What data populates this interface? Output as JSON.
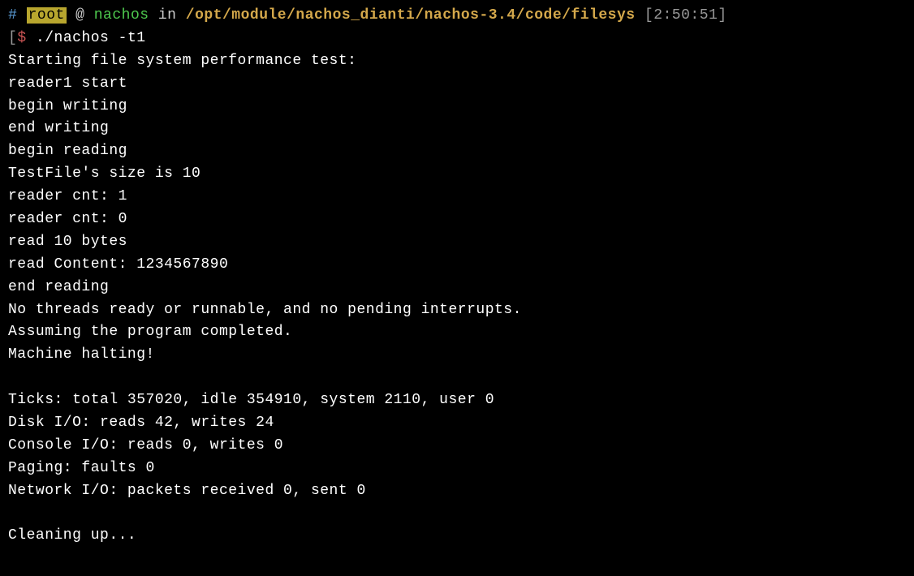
{
  "prompt": {
    "hash": "#",
    "user": "root",
    "at": " @ ",
    "hostname": "nachos",
    "in": " in ",
    "path": "/opt/module/nachos_dianti/nachos-3.4/code/filesys",
    "timestamp": "2:50:51",
    "lbracket": " [",
    "rbracket": "]"
  },
  "command_line": {
    "lbracket": "[",
    "dollar": "$",
    "space": " ",
    "command": "./nachos -t1"
  },
  "output": [
    "Starting file system performance test:",
    "reader1 start",
    "begin writing",
    "end writing",
    "begin reading",
    "TestFile's size is 10",
    "reader cnt: 1",
    "reader cnt: 0",
    "read 10 bytes",
    "read Content: 1234567890",
    "end reading",
    "No threads ready or runnable, and no pending interrupts.",
    "Assuming the program completed.",
    "Machine halting!",
    "",
    "Ticks: total 357020, idle 354910, system 2110, user 0",
    "Disk I/O: reads 42, writes 24",
    "Console I/O: reads 0, writes 0",
    "Paging: faults 0",
    "Network I/O: packets received 0, sent 0",
    "",
    "Cleaning up..."
  ]
}
